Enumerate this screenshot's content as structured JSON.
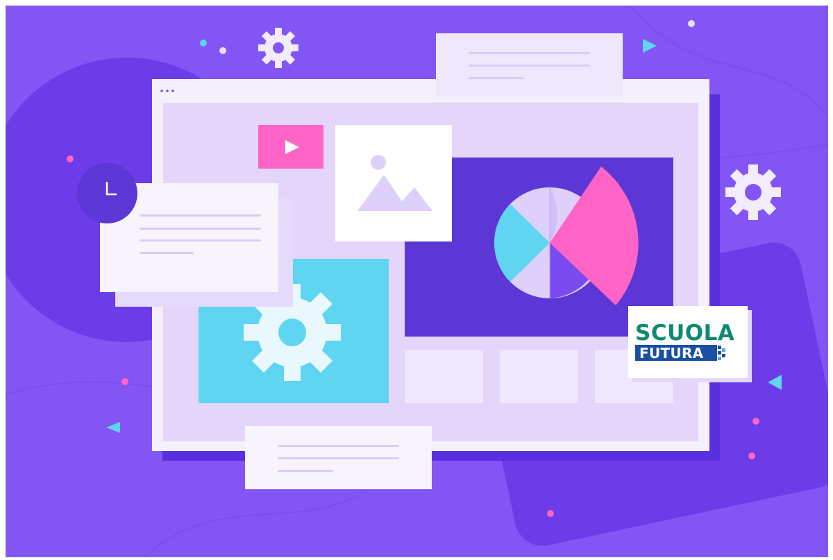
{
  "colors": {
    "background": "#8455f5",
    "window_frame": "#f4f0fc",
    "window_inner": "#e4d5fb",
    "dark_panel": "#5c37d6",
    "accent_cyan": "#5fd5f2",
    "accent_pink": "#ff64c6",
    "logo_green": "#0f8a73",
    "logo_blue": "#1a4fa3"
  },
  "icons": [
    "gear-icon",
    "play-icon",
    "image-icon",
    "clock-icon",
    "pie-chart-icon"
  ],
  "logo": {
    "line1": "SCUOLA",
    "line2": "FUTURA"
  }
}
